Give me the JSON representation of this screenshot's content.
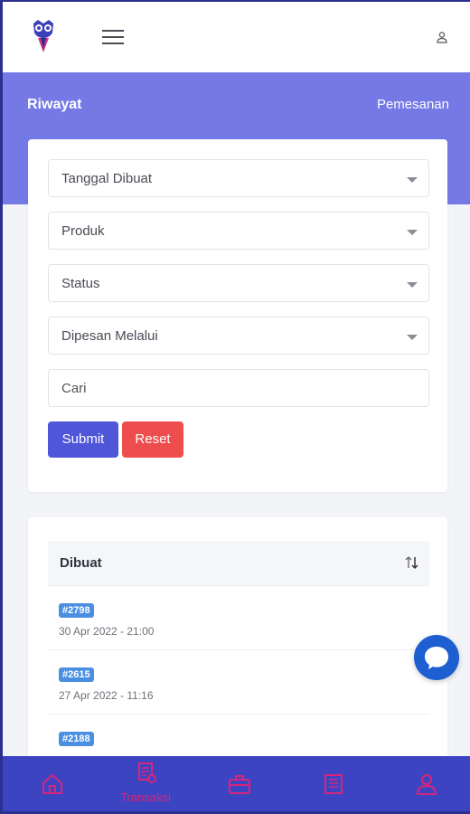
{
  "header": {
    "logo_icon": "owl-logo-icon",
    "menu_icon": "hamburger-icon",
    "user_icon": "user-icon"
  },
  "hero": {
    "title": "Riwayat",
    "link": "Pemesanan",
    "color": "#7479e6"
  },
  "filters": {
    "created_date": "Tanggal Dibuat",
    "product": "Produk",
    "status": "Status",
    "ordered_via": "Dipesan Melalui",
    "search_placeholder": "Cari",
    "submit_label": "Submit",
    "reset_label": "Reset",
    "submit_color": "#4f56d8",
    "reset_color": "#ee4d4d"
  },
  "table": {
    "header": "Dibuat",
    "sort_icon": "sort-arrows-icon",
    "rows": [
      {
        "id": "#2798",
        "date": "30 Apr 2022 - 21:00"
      },
      {
        "id": "#2615",
        "date": "27 Apr 2022 - 11:16"
      },
      {
        "id": "#2188",
        "date": ""
      }
    ]
  },
  "chat": {
    "icon": "chat-bubble-icon",
    "color": "#1d5fd1"
  },
  "bottom_nav": {
    "color": "#3d44c2",
    "accent": "#d8247a",
    "items": [
      {
        "icon": "home-icon",
        "label": ""
      },
      {
        "icon": "transaction-icon",
        "label": "Transaksi"
      },
      {
        "icon": "briefcase-icon",
        "label": ""
      },
      {
        "icon": "document-icon",
        "label": ""
      },
      {
        "icon": "profile-icon",
        "label": ""
      }
    ]
  }
}
